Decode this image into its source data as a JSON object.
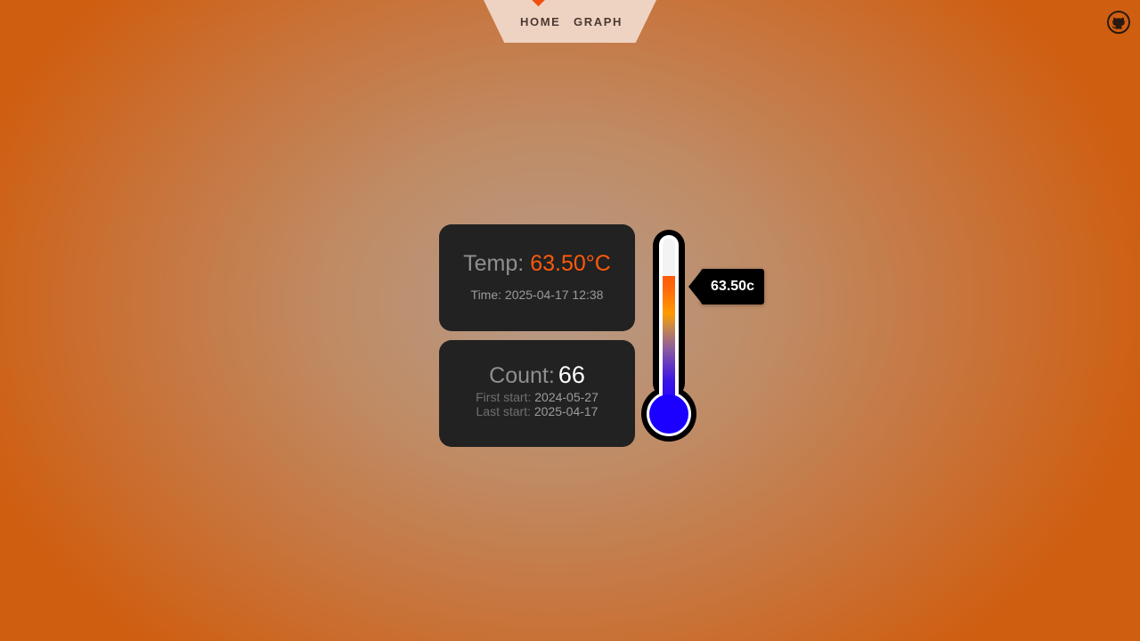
{
  "nav": {
    "home_label": "HOME",
    "graph_label": "GRAPH"
  },
  "temperature_card": {
    "label": "Temp:",
    "value": "63.50°C",
    "time_label": "Time:",
    "time_value": "2025-04-17 12:38"
  },
  "count_card": {
    "label": "Count:",
    "value": "66",
    "first_start_label": "First start:",
    "first_start_value": "2024-05-27",
    "last_start_label": "Last start:",
    "last_start_value": "2025-04-17"
  },
  "thermometer": {
    "tooltip": "63.50c",
    "fill_colors": [
      "#1b00ff",
      "#8a5aa0",
      "#ff9a00",
      "#ff5a0a"
    ]
  },
  "icons": {
    "github": "github-icon",
    "nav_marker": "diamond-marker-icon"
  },
  "colors": {
    "accent": "#ff5a0a",
    "card_bg": "#222222",
    "nav_bg": "#efd3c2"
  }
}
